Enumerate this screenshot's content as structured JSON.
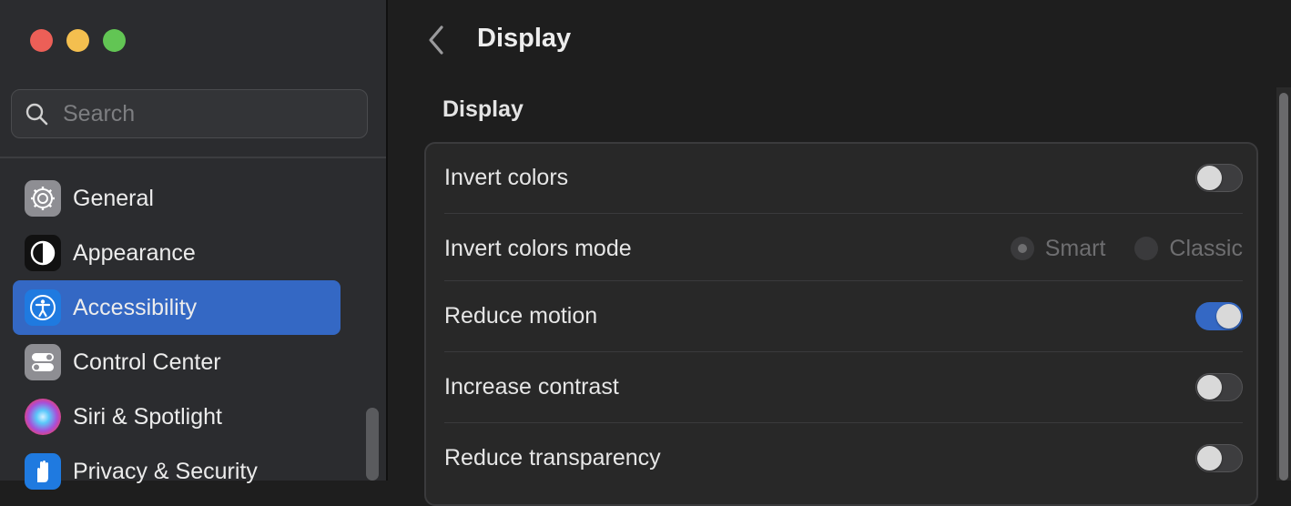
{
  "sidebar": {
    "search": {
      "placeholder": "Search",
      "value": ""
    },
    "items": [
      {
        "label": "General",
        "icon": "gear-icon",
        "active": false
      },
      {
        "label": "Appearance",
        "icon": "appearance-icon",
        "active": false
      },
      {
        "label": "Accessibility",
        "icon": "accessibility-icon",
        "active": true
      },
      {
        "label": "Control Center",
        "icon": "control-center-icon",
        "active": false
      },
      {
        "label": "Siri & Spotlight",
        "icon": "siri-icon",
        "active": false
      },
      {
        "label": "Privacy & Security",
        "icon": "hand-icon",
        "active": false
      }
    ]
  },
  "header": {
    "title": "Display"
  },
  "section": {
    "title": "Display",
    "rows": [
      {
        "label": "Invert colors",
        "control": "toggle",
        "state": "off"
      },
      {
        "label": "Invert colors mode",
        "control": "radio",
        "options": [
          "Smart",
          "Classic"
        ],
        "selected": "Smart",
        "enabled": false
      },
      {
        "label": "Reduce motion",
        "control": "toggle",
        "state": "on"
      },
      {
        "label": "Increase contrast",
        "control": "toggle",
        "state": "off"
      },
      {
        "label": "Reduce transparency",
        "control": "toggle",
        "state": "off"
      }
    ]
  },
  "colors": {
    "accent": "#3468c4",
    "sidebar_bg": "#2b2c2f",
    "content_bg": "#1e1e1e",
    "group_bg": "#282828"
  }
}
